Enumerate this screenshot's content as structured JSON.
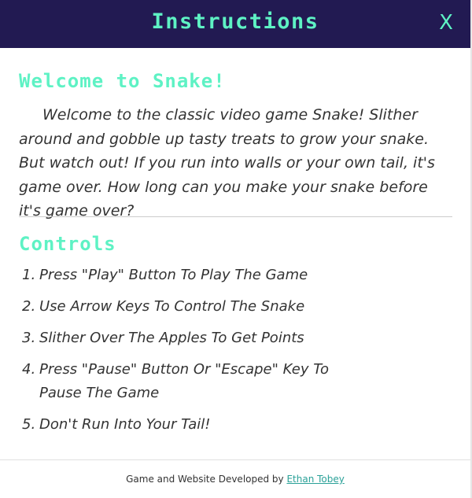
{
  "modal": {
    "title": "Instructions",
    "close_label": "X"
  },
  "welcome": {
    "heading": "Welcome to Snake!",
    "text": "Welcome to the classic video game Snake! Slither around and gobble up tasty treats to grow your snake. But watch out! If you run into walls or your own tail, it's game over. How long can you make your snake before it's game over?"
  },
  "controls": {
    "heading": "Controls",
    "items": [
      {
        "num": "1.",
        "text": "Press \"Play\" Button To Play The Game"
      },
      {
        "num": "2.",
        "text": "Use Arrow Keys To Control The Snake"
      },
      {
        "num": "3.",
        "text": "Slither Over The Apples To Get Points"
      },
      {
        "num": "4.",
        "text": "Press \"Pause\" Button Or \"Escape\" Key To Pause The Game"
      },
      {
        "num": "5.",
        "text": "Don't Run Into Your Tail!"
      }
    ]
  },
  "footer": {
    "prefix": "Game and Website Developed by ",
    "author": "Ethan Tobey"
  },
  "colors": {
    "header_bg": "#221a52",
    "accent": "#5ef2c4",
    "text": "#333333",
    "link": "#2aa198"
  }
}
